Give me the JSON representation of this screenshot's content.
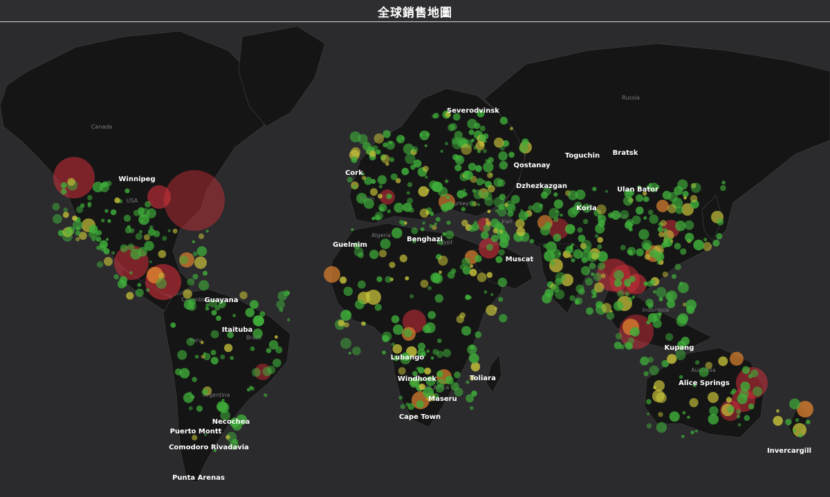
{
  "header": {
    "title": "全球銷售地圖"
  },
  "map": {
    "colors": {
      "ocean": "#2b2a2d",
      "land": "#151515",
      "border": "#3a3a3c",
      "low": "#3fae3a",
      "mid": "#c7c23a",
      "high": "#e0832f",
      "top": "#d0303a"
    },
    "country_labels": [
      "Canada",
      "USA",
      "Colombia",
      "Peru",
      "Brazil",
      "Argentina",
      "Spain",
      "Algeria",
      "Egypt",
      "Iran",
      "Turkey",
      "South Africa",
      "China",
      "Russia",
      "Indonesia",
      "Australia"
    ],
    "city_labels": [
      "Winnipeg",
      "Guayana",
      "Itaituba",
      "Necochea",
      "Puerto Montt",
      "Comodoro Rivadavia",
      "Punta Arenas",
      "Cork",
      "Guelmim",
      "Benghazi",
      "Severodvinsk",
      "Qostanay",
      "Toguchin",
      "Bratsk",
      "Dzhezkazgan",
      "Ulan Bator",
      "Korla",
      "Muscat",
      "Lubango",
      "Windhoek",
      "Maseru",
      "Cape Town",
      "Toliara",
      "Kupang",
      "Alice Springs",
      "Invercargill"
    ]
  }
}
